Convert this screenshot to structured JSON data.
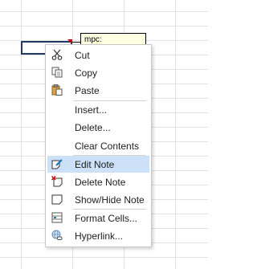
{
  "comment": {
    "text": "mpc:"
  },
  "context_menu": {
    "items": [
      {
        "label": "Cut",
        "icon": "scissors-icon"
      },
      {
        "label": "Copy",
        "icon": "copy-icon"
      },
      {
        "label": "Paste",
        "icon": "paste-icon"
      },
      {
        "label": "Insert..."
      },
      {
        "label": "Delete..."
      },
      {
        "label": "Clear Contents"
      },
      {
        "label": "Edit Note",
        "icon": "edit-note-icon",
        "highlighted": true
      },
      {
        "label": "Delete Note",
        "icon": "delete-note-icon"
      },
      {
        "label": "Show/Hide Note",
        "icon": "show-hide-note-icon"
      },
      {
        "label": "Format Cells...",
        "icon": "format-cells-icon"
      },
      {
        "label": "Hyperlink...",
        "icon": "hyperlink-icon"
      }
    ]
  },
  "colors": {
    "highlight": "#cce0f7",
    "note_background": "#ffffe1",
    "note_marker": "#d40000"
  }
}
